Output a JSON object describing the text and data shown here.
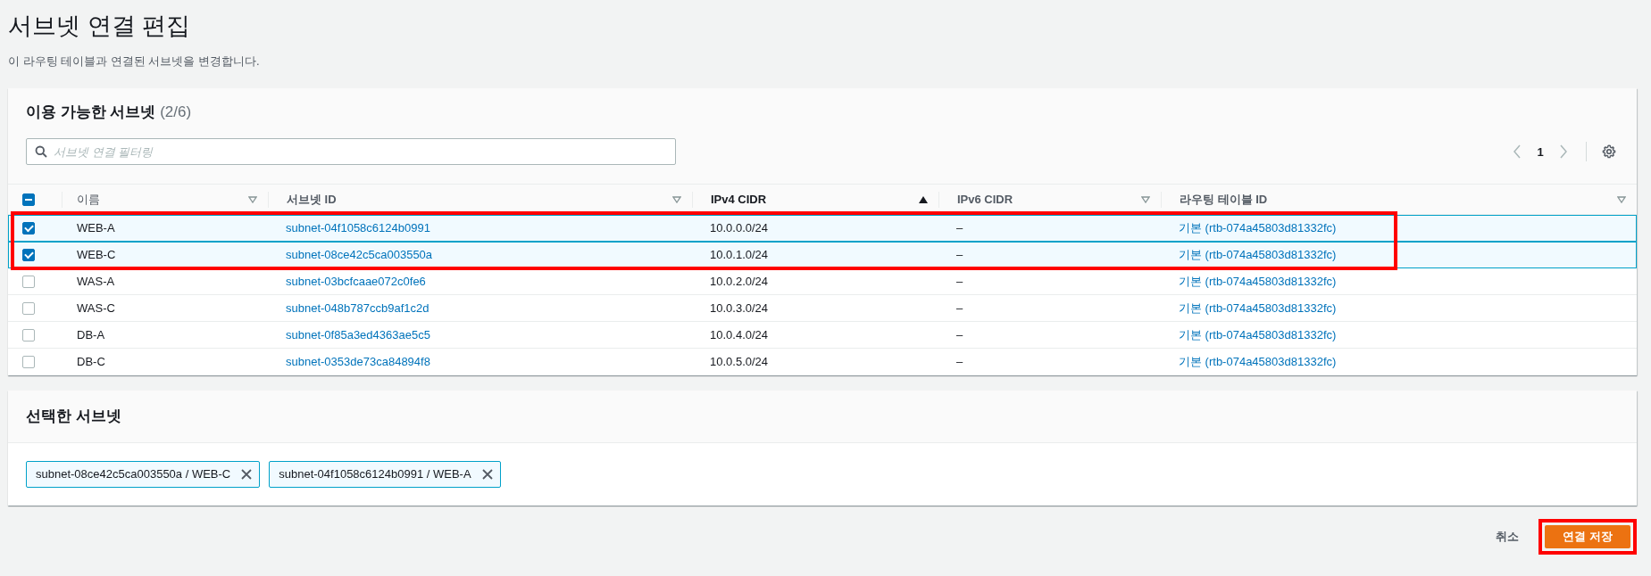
{
  "page": {
    "title": "서브넷 연결 편집",
    "description": "이 라우팅 테이블과 연결된 서브넷을 변경합니다."
  },
  "available": {
    "title": "이용 가능한 서브넷",
    "count": "(2/6)",
    "filter": {
      "placeholder": "서브넷 연결 필터링"
    },
    "page": "1",
    "select_all_partial": true,
    "columns": [
      {
        "label": "이름",
        "sorted": false
      },
      {
        "label": "서브넷 ID",
        "sorted": false
      },
      {
        "label": "IPv4 CIDR",
        "sorted": true
      },
      {
        "label": "IPv6 CIDR",
        "sorted": false
      },
      {
        "label": "라우팅 테이블 ID",
        "sorted": false
      }
    ],
    "rows": [
      {
        "name": "WEB-A",
        "subnet_id": "subnet-04f1058c6124b0991",
        "ipv4": "10.0.0.0/24",
        "ipv6": "–",
        "route_table": "기본 (rtb-074a45803d81332fc)",
        "selected": true,
        "framed": true
      },
      {
        "name": "WEB-C",
        "subnet_id": "subnet-08ce42c5ca003550a",
        "ipv4": "10.0.1.0/24",
        "ipv6": "–",
        "route_table": "기본 (rtb-074a45803d81332fc)",
        "selected": true,
        "framed": true
      },
      {
        "name": "WAS-A",
        "subnet_id": "subnet-03bcfcaae072c0fe6",
        "ipv4": "10.0.2.0/24",
        "ipv6": "–",
        "route_table": "기본 (rtb-074a45803d81332fc)",
        "selected": false,
        "framed": false
      },
      {
        "name": "WAS-C",
        "subnet_id": "subnet-048b787ccb9af1c2d",
        "ipv4": "10.0.3.0/24",
        "ipv6": "–",
        "route_table": "기본 (rtb-074a45803d81332fc)",
        "selected": false,
        "framed": false
      },
      {
        "name": "DB-A",
        "subnet_id": "subnet-0f85a3ed4363ae5c5",
        "ipv4": "10.0.4.0/24",
        "ipv6": "–",
        "route_table": "기본 (rtb-074a45803d81332fc)",
        "selected": false,
        "framed": false
      },
      {
        "name": "DB-C",
        "subnet_id": "subnet-0353de73ca84894f8",
        "ipv4": "10.0.5.0/24",
        "ipv6": "–",
        "route_table": "기본 (rtb-074a45803d81332fc)",
        "selected": false,
        "framed": false
      }
    ]
  },
  "selected": {
    "title": "선택한 서브넷",
    "tokens": [
      "subnet-08ce42c5ca003550a / WEB-C",
      "subnet-04f1058c6124b0991 / WEB-A"
    ]
  },
  "actions": {
    "cancel": "취소",
    "save": {
      "label": "연결 저장",
      "framed": true
    }
  }
}
